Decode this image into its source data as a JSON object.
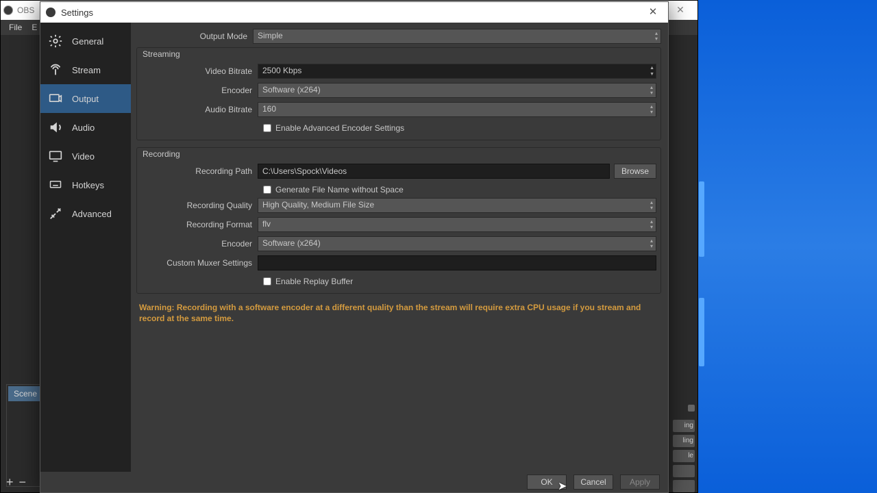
{
  "mainWindow": {
    "title": "OBS",
    "menu": {
      "file": "File",
      "edit": "E"
    },
    "scene_label": "Scene",
    "close_glyph": "✕"
  },
  "rightStrips": [
    "ing",
    "ling",
    "le",
    "",
    ""
  ],
  "settings": {
    "title": "Settings",
    "close_glyph": "✕",
    "sidebar": {
      "general": "General",
      "stream": "Stream",
      "output": "Output",
      "audio": "Audio",
      "video": "Video",
      "hotkeys": "Hotkeys",
      "advanced": "Advanced"
    },
    "labels": {
      "output_mode": "Output Mode",
      "streaming": "Streaming",
      "video_bitrate": "Video Bitrate",
      "encoder": "Encoder",
      "audio_bitrate": "Audio Bitrate",
      "enable_adv": "Enable Advanced Encoder Settings",
      "recording": "Recording",
      "recording_path": "Recording Path",
      "gen_filename": "Generate File Name without Space",
      "recording_quality": "Recording Quality",
      "recording_format": "Recording Format",
      "custom_muxer": "Custom Muxer Settings",
      "enable_replay": "Enable Replay Buffer",
      "browse": "Browse"
    },
    "values": {
      "output_mode": "Simple",
      "video_bitrate": "2500 Kbps",
      "stream_encoder": "Software (x264)",
      "audio_bitrate": "160",
      "recording_path": "C:\\Users\\Spock\\Videos",
      "recording_quality": "High Quality, Medium File Size",
      "recording_format": "flv",
      "rec_encoder": "Software (x264)",
      "custom_muxer": ""
    },
    "warning": "Warning: Recording with a software encoder at a different quality than the stream will require extra CPU usage if you stream and record at the same time.",
    "footer": {
      "ok": "OK",
      "cancel": "Cancel",
      "apply": "Apply"
    }
  },
  "glyphs": {
    "plus": "+",
    "minus": "−",
    "updown": "▴\n▾"
  }
}
